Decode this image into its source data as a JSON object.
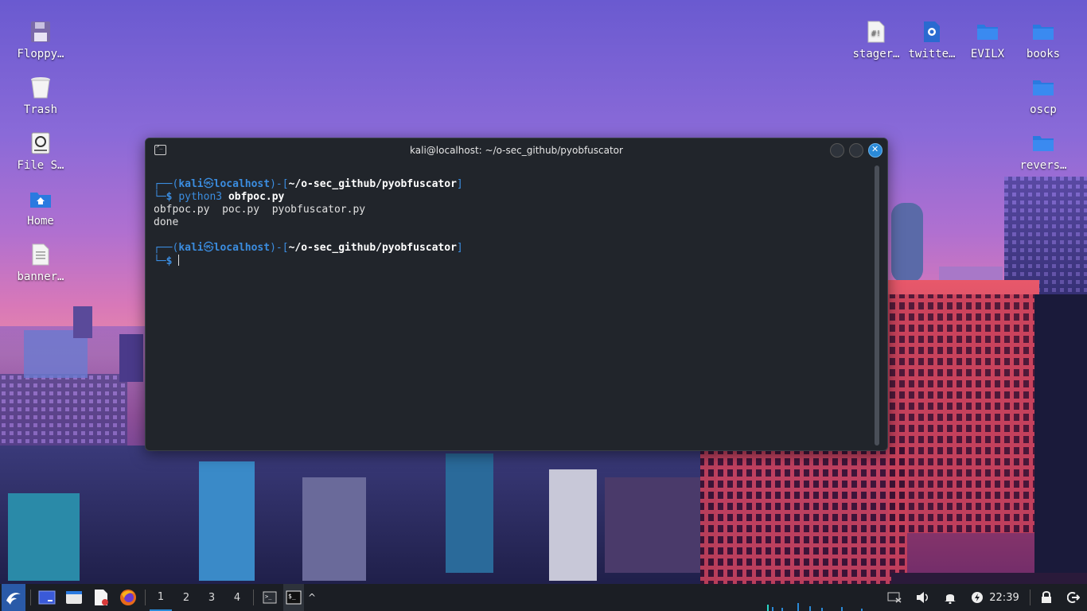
{
  "desktop_left": [
    {
      "label": "Floppy…",
      "icon": "floppy-icon"
    },
    {
      "label": "Trash",
      "icon": "trash-icon"
    },
    {
      "label": "File S…",
      "icon": "drive-icon"
    },
    {
      "label": "Home",
      "icon": "home-folder-icon"
    },
    {
      "label": "banner…",
      "icon": "text-file-icon"
    }
  ],
  "desktop_right": [
    {
      "label": "stager…",
      "icon": "script-file-icon"
    },
    {
      "label": "twitte…",
      "icon": "python-file-icon"
    },
    {
      "label": "EVILX",
      "icon": "folder-icon"
    },
    {
      "label": "books",
      "icon": "folder-icon"
    },
    {
      "label": "oscp",
      "icon": "folder-icon"
    },
    {
      "label": "revers…",
      "icon": "folder-icon"
    }
  ],
  "terminal": {
    "title": "kali@localhost: ~/o-sec_github/pyobfuscator",
    "prompt1": {
      "open": "┌──(",
      "user": "kali",
      "at": "㉿",
      "host": "localhost",
      "mid": ")-[",
      "path": "~/o-sec_github/pyobfuscator",
      "close": "]"
    },
    "cmd1": {
      "prefix": "└─",
      "dollar": "$",
      "command": "python3",
      "arg": "obfpoc.py"
    },
    "output1": "obfpoc.py  poc.py  pyobfuscator.py",
    "output2": "done",
    "prompt2": {
      "open": "┌──(",
      "user": "kali",
      "at": "㉿",
      "host": "localhost",
      "mid": ")-[",
      "path": "~/o-sec_github/pyobfuscator",
      "close": "]"
    },
    "cmd2": {
      "prefix": "└─",
      "dollar": "$"
    }
  },
  "taskbar": {
    "workspaces": [
      "1",
      "2",
      "3",
      "4"
    ],
    "active_workspace": "1",
    "clock": "22:39",
    "accent": "#2a8ad8"
  }
}
